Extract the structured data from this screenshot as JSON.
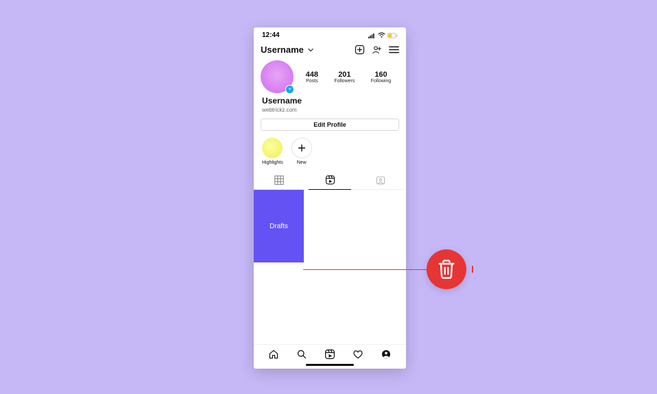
{
  "status": {
    "time": "12:44"
  },
  "header": {
    "username": "Username"
  },
  "stats": {
    "posts": {
      "count": "448",
      "label": "Posts"
    },
    "followers": {
      "count": "201",
      "label": "Followers"
    },
    "following": {
      "count": "160",
      "label": "Following"
    }
  },
  "profile": {
    "display_name": "Username",
    "website": "webtrickz.com",
    "edit_label": "Edit Profile"
  },
  "highlights": {
    "first": "Highlights",
    "new": "New"
  },
  "content": {
    "drafts_label": "Drafts"
  }
}
